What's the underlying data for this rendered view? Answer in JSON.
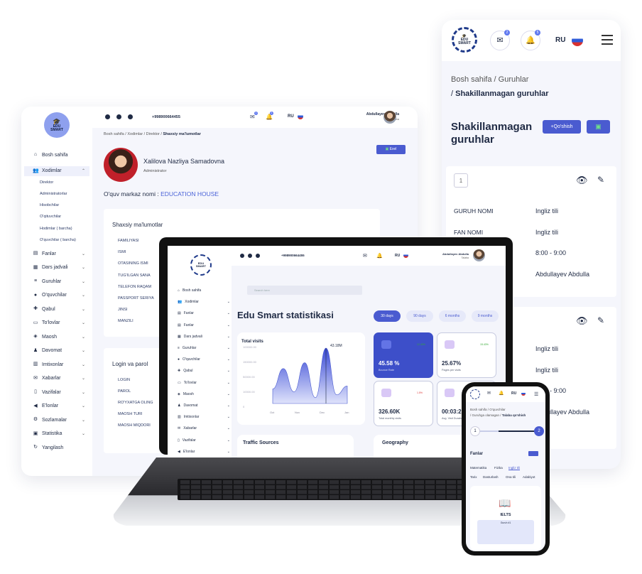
{
  "desktop": {
    "logo": "EDU SMART",
    "sidebar": [
      {
        "label": "Bosh sahifa",
        "icon": "home-icon",
        "expand": false
      },
      {
        "label": "Xodimlar",
        "icon": "users-icon",
        "expand": true
      },
      {
        "label": "Fanlar",
        "icon": "book-icon",
        "expand": true
      },
      {
        "label": "Dars jadvali",
        "icon": "calendar-icon",
        "expand": true
      },
      {
        "label": "Guruhlar",
        "icon": "groups-icon",
        "expand": true
      },
      {
        "label": "O'quvchilar",
        "icon": "student-icon",
        "expand": true
      },
      {
        "label": "Qabul",
        "icon": "admission-icon",
        "expand": true
      },
      {
        "label": "To'lovlar",
        "icon": "payment-icon",
        "expand": true
      },
      {
        "label": "Maosh",
        "icon": "salary-icon",
        "expand": true
      },
      {
        "label": "Davomat",
        "icon": "attendance-icon",
        "expand": true
      },
      {
        "label": "Imtixonlar",
        "icon": "exam-icon",
        "expand": true
      },
      {
        "label": "Xabarlar",
        "icon": "mail-icon",
        "expand": true
      },
      {
        "label": "Vazifalar",
        "icon": "tasks-icon",
        "expand": true
      },
      {
        "label": "E'lonlar",
        "icon": "megaphone-icon",
        "expand": true
      },
      {
        "label": "Sozlamalar",
        "icon": "gear-icon",
        "expand": true
      },
      {
        "label": "Statistika",
        "icon": "chart-icon",
        "expand": true
      },
      {
        "label": "Yangilash",
        "icon": "refresh-icon",
        "expand": false
      }
    ],
    "subitems": [
      "Direktor",
      "Administratorlar",
      "Hisobchilar",
      "O'qituvchilar",
      "Hodimlar ( barcha)",
      "O'quvchilar ( barcha)"
    ],
    "phone": "+998900664455",
    "mail_count": "1",
    "notif_count": "1",
    "lang": "RU",
    "user_name": "Abdullayev Abdulla",
    "user_role": "Talaba",
    "breadcrumb": [
      "Bosh sahifa",
      "Xodimlar",
      "Direktor",
      "Shaxsiy ma'lumotlar"
    ],
    "excel_label": "Exel",
    "profile_name": "Xalilova Nazliya Samadovna",
    "profile_role": "Administrator",
    "center_label": "O'quv markaz nomi :",
    "center_name": "EDUCATION HOUSE",
    "personal_title": "Shaxsiy ma'lumotlar",
    "personal_fields": [
      "FAMILIYASI",
      "ISMI",
      "OTASINING ISMI",
      "TUG'ILGAN SANA",
      "TELEFON RAQAM",
      "PASSPORT SERIYA",
      "JINSI",
      "MANZILI"
    ],
    "login_title": "Login va parol",
    "login_fields": [
      "LOGIN",
      "PAROL",
      "RO'YXATGA OLING",
      "MAOSH TURI",
      "MAOSH MIQDORI"
    ]
  },
  "tablet": {
    "mail_count": "2",
    "notif_count": "5",
    "lang": "RU",
    "crumb1": "Bosh sahifa",
    "crumb2": "Guruhlar",
    "crumb3": "Shakillanmagan guruhlar",
    "title": "Shakillanmagan guruhlar",
    "add_label": "+Qo'shish",
    "card1": {
      "num": "1",
      "rows": [
        {
          "k": "GURUH NOMI",
          "v": "Ingliz tili"
        },
        {
          "k": "FAN NOMI",
          "v": "Ingliz tili"
        },
        {
          "k": "",
          "v": "8:00 - 9:00"
        },
        {
          "k": "",
          "v": "Abdullayev Abdulla"
        }
      ]
    },
    "card2": {
      "rows": [
        "Ingliz tili",
        "Ingliz tili",
        "8:00 - 9:00",
        "Abdullayev Abdulla"
      ]
    }
  },
  "laptop": {
    "phone": "+998900664455",
    "user_name": "Abdullayev Abdulla",
    "user_role": "Talaba",
    "lang": "RU",
    "search_placeholder": "Search here",
    "sidebar": [
      "Bosh sahifa",
      "Xodimlar",
      "Fanlar",
      "Fanlar",
      "Dars jadvali",
      "Guruhlar",
      "O'quvchilar",
      "Qabul",
      "To'lovlar",
      "Maosh",
      "Davomat",
      "Imtixonlar",
      "Xabarlar",
      "Vazifalar",
      "E'lonlar"
    ],
    "title": "Edu Smart statistikasi",
    "ranges": [
      "30 days",
      "90 days",
      "6 months",
      "9 months"
    ],
    "total_visits": "Total visits",
    "peak_label": "43.18M",
    "kpis": [
      {
        "value": "45.58 %",
        "label": "Bounce Rate",
        "delta": "12.43%"
      },
      {
        "value": "25.67%",
        "label": "Pages per visits",
        "delta": "15.43%"
      },
      {
        "value": "326.60K",
        "label": "Total monthly visits",
        "delta": "1.5%"
      },
      {
        "value": "00:03:2",
        "label": "Avg. Visit Duration",
        "delta": ""
      }
    ],
    "traffic": "Traffic Sources",
    "geo": "Geography"
  },
  "chart_data": {
    "type": "area",
    "title": "Total visits",
    "x": [
      "Oct",
      "Nov",
      "Dec",
      "Jan"
    ],
    "ylabels": [
      "100000.00",
      "150000.00",
      "50000.00",
      "10000.00",
      "0"
    ],
    "values": [
      25,
      60,
      20,
      70,
      10,
      95,
      15,
      30
    ],
    "peak_label": "43.18M"
  },
  "phone": {
    "crumb1": "Bosh sahifa",
    "crumb2": "O'quvchilar",
    "crumb3": "Guruhga olamagan",
    "crumb4": "Talaba qo'shish",
    "step1": "1",
    "step2": "2",
    "section": "Fanlar",
    "tabs1": [
      "Matematika",
      "Fizika",
      "Ingliz tili"
    ],
    "tabs2": [
      "Tarix",
      "Dasturlash",
      "Ona tili",
      "Adabiyot"
    ],
    "course": "IELTS",
    "course_sub": "Guruh #1"
  }
}
